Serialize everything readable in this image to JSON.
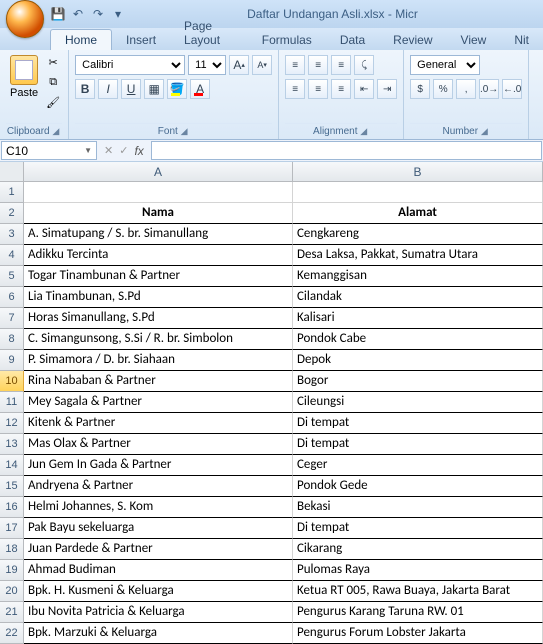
{
  "title": "Daftar Undangan Asli.xlsx - Micr",
  "qat": {
    "save": "💾",
    "undo": "↶",
    "redo": "↷",
    "more": "▾"
  },
  "tabs": [
    "Home",
    "Insert",
    "Page Layout",
    "Formulas",
    "Data",
    "Review",
    "View",
    "Nit"
  ],
  "active_tab": "Home",
  "ribbon": {
    "clipboard": {
      "label": "Clipboard",
      "paste": "Paste"
    },
    "font": {
      "label": "Font",
      "name": "Calibri",
      "size": "11",
      "grow": "A",
      "shrink": "A",
      "bold": "B",
      "italic": "I",
      "underline": "U"
    },
    "alignment": {
      "label": "Alignment"
    },
    "number": {
      "label": "Number",
      "format": "General",
      "currency": "$",
      "percent": "%",
      "comma": ","
    }
  },
  "namebox": "C10",
  "fx_label": "fx",
  "columns": [
    "A",
    "B"
  ],
  "headers": {
    "A": "Nama",
    "B": "Alamat"
  },
  "selected_row": 10,
  "chart_data": {
    "type": "table",
    "columns": [
      "Nama",
      "Alamat"
    ],
    "rows": [
      [
        "A. Simatupang / S. br. Simanullang",
        "Cengkareng"
      ],
      [
        "Adikku Tercinta",
        "Desa Laksa, Pakkat, Sumatra Utara"
      ],
      [
        "Togar Tinambunan & Partner",
        "Kemanggisan"
      ],
      [
        "Lia Tinambunan, S.Pd",
        "Cilandak"
      ],
      [
        "Horas Simanullang, S.Pd",
        "Kalisari"
      ],
      [
        "C. Simangunsong, S.Si / R. br. Simbolon",
        "Pondok Cabe"
      ],
      [
        "P. Simamora / D. br. Siahaan",
        "Depok"
      ],
      [
        "Rina Nababan & Partner",
        "Bogor"
      ],
      [
        "Mey Sagala & Partner",
        "Cileungsi"
      ],
      [
        "Kitenk & Partner",
        "Di tempat"
      ],
      [
        "Mas Olax & Partner",
        "Di tempat"
      ],
      [
        "Jun Gem In Gada & Partner",
        "Ceger"
      ],
      [
        "Andryena & Partner",
        "Pondok Gede"
      ],
      [
        "Helmi Johannes, S. Kom",
        "Bekasi"
      ],
      [
        "Pak Bayu sekeluarga",
        "Di tempat"
      ],
      [
        "Juan Pardede & Partner",
        "Cikarang"
      ],
      [
        "Ahmad Budiman",
        "Pulomas Raya"
      ],
      [
        "Bpk. H. Kusmeni & Keluarga",
        "Ketua RT 005, Rawa Buaya, Jakarta Barat"
      ],
      [
        "Ibu Novita Patricia & Keluarga",
        "Pengurus Karang Taruna RW. 01"
      ],
      [
        "Bpk. Marzuki & Keluarga",
        "Pengurus Forum Lobster Jakarta"
      ]
    ]
  }
}
